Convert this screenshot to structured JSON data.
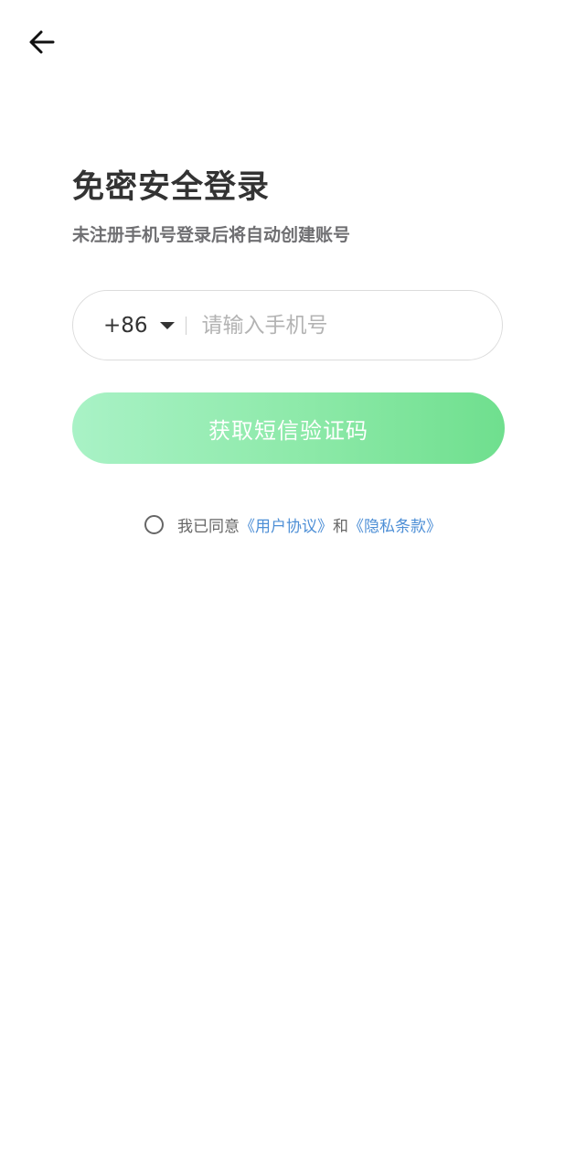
{
  "header": {
    "back_icon": "arrow-left-icon"
  },
  "login": {
    "title": "免密安全登录",
    "subtitle": "未注册手机号登录后将自动创建账号",
    "country_code": "+86",
    "phone_placeholder": "请输入手机号",
    "phone_value": "",
    "sms_button_label": "获取短信验证码"
  },
  "agreement": {
    "checked": false,
    "prefix": "我已同意",
    "user_agreement": "《用户协议》",
    "and": "和",
    "privacy_policy": "《隐私条款》"
  },
  "colors": {
    "accent_green_start": "#a9f2c6",
    "accent_green_end": "#6fdf8e",
    "link_blue": "#4e8fd6",
    "title_text": "#333333",
    "subtitle_text": "#6f6f72"
  }
}
